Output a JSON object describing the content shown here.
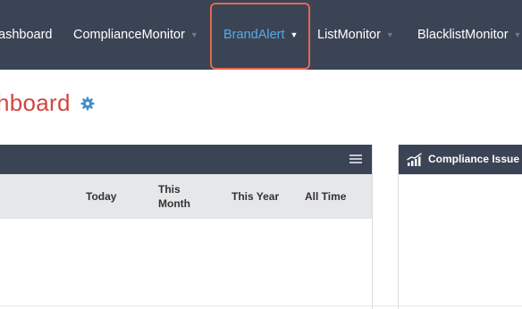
{
  "nav": {
    "items": [
      {
        "label": "ashboard"
      },
      {
        "label": "ComplianceMonitor"
      },
      {
        "label": "BrandAlert"
      },
      {
        "label": "ListMonitor"
      },
      {
        "label": "BlacklistMonitor"
      }
    ],
    "active": "BrandAlert",
    "highlight_color": "#e2684f",
    "active_color": "#5aa8e8",
    "bar_color": "#3b4454"
  },
  "page": {
    "title": "hboard",
    "title_color": "#d2453f",
    "settings_icon": "gear-icon"
  },
  "left_panel": {
    "menu_icon": "hamburger-icon",
    "columns": [
      "Today",
      "This Month",
      "This Year",
      "All Time"
    ]
  },
  "right_panel": {
    "icon": "bar-chart-icon",
    "title": "Compliance Issue"
  }
}
